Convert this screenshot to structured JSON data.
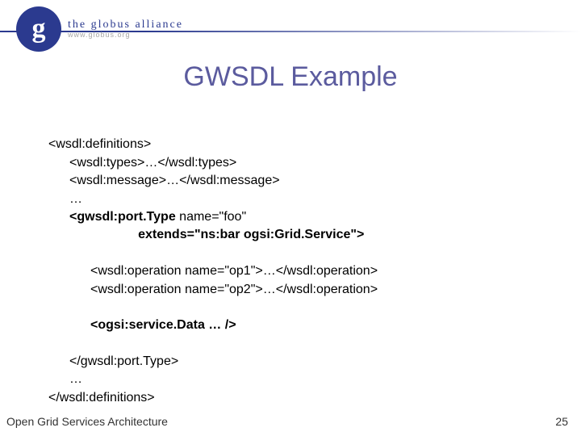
{
  "logo": {
    "glyph": "g",
    "topline": "the globus alliance",
    "subline": "www.globus.org"
  },
  "title": "GWSDL Example",
  "code": {
    "l1": "<wsdl:definitions>",
    "l2": "<wsdl:types>…</wsdl:types>",
    "l3": "<wsdl:message>…</wsdl:message>",
    "l4": "…",
    "l5a": "<gwsdl:port.Type",
    "l5b": " name=\"foo\"",
    "l6": "                         extends=\"ns:bar ogsi:Grid.Service\">",
    "l7": "<wsdl:operation name=\"op1\">…</wsdl:operation>",
    "l8": "<wsdl:operation name=\"op2\">…</wsdl:operation>",
    "l9": "<ogsi:service.Data … />",
    "l10": "</gwsdl:port.Type>",
    "l11": "…",
    "l12": "</wsdl:definitions>"
  },
  "footer": {
    "left": "Open Grid Services Architecture",
    "right": "25"
  }
}
